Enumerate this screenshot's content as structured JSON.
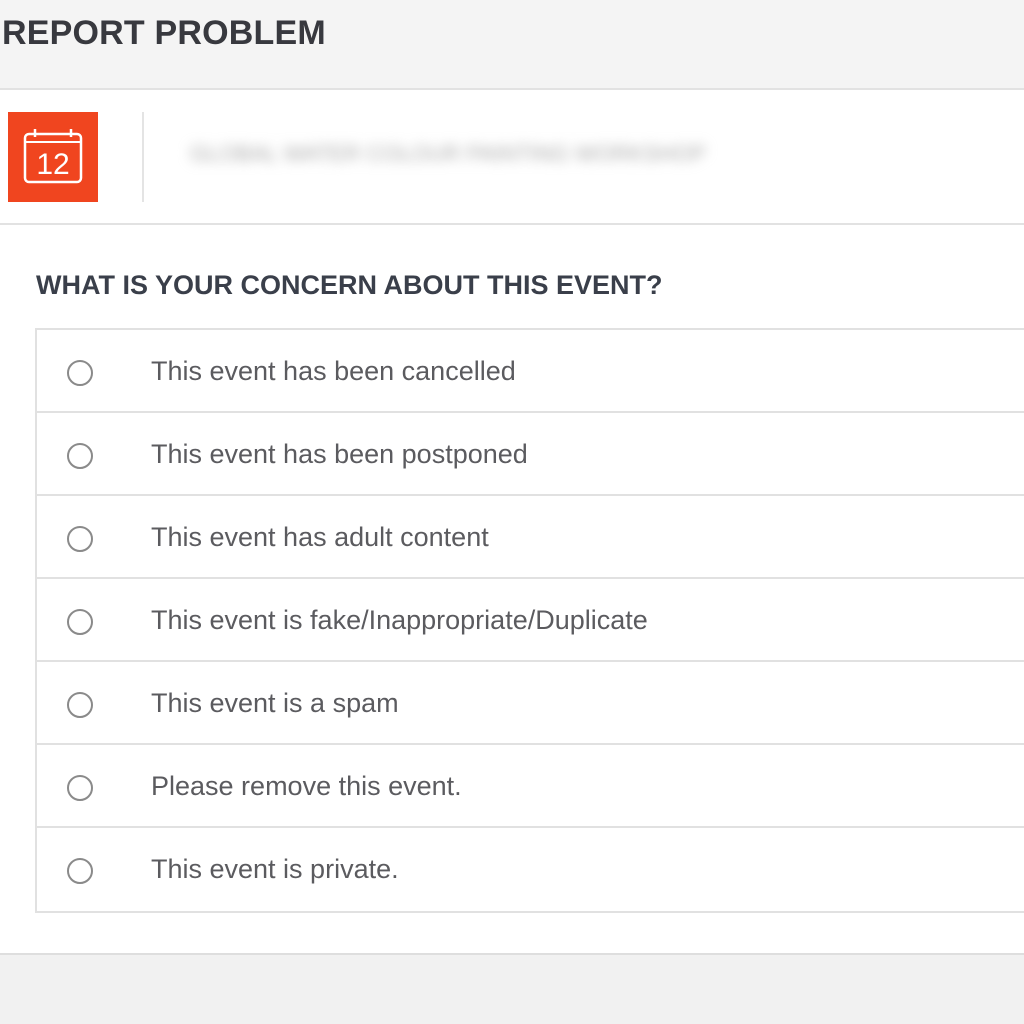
{
  "header": {
    "title": "REPORT PROBLEM"
  },
  "event": {
    "icon": "calendar-icon",
    "icon_day": "12",
    "icon_color": "#f0451f",
    "name_blurred": "GLOBAL WATER COLOUR PAINTING WORKSHOP"
  },
  "form": {
    "question": "WHAT IS YOUR CONCERN ABOUT THIS EVENT?",
    "options": [
      {
        "label": "This event has been cancelled",
        "selected": false
      },
      {
        "label": "This event has been postponed",
        "selected": false
      },
      {
        "label": "This event has adult content",
        "selected": false
      },
      {
        "label": "This event is fake/Inappropriate/Duplicate",
        "selected": false
      },
      {
        "label": "This event is a spam",
        "selected": false
      },
      {
        "label": "Please remove this event.",
        "selected": false
      },
      {
        "label": "This event is private.",
        "selected": false
      }
    ]
  }
}
